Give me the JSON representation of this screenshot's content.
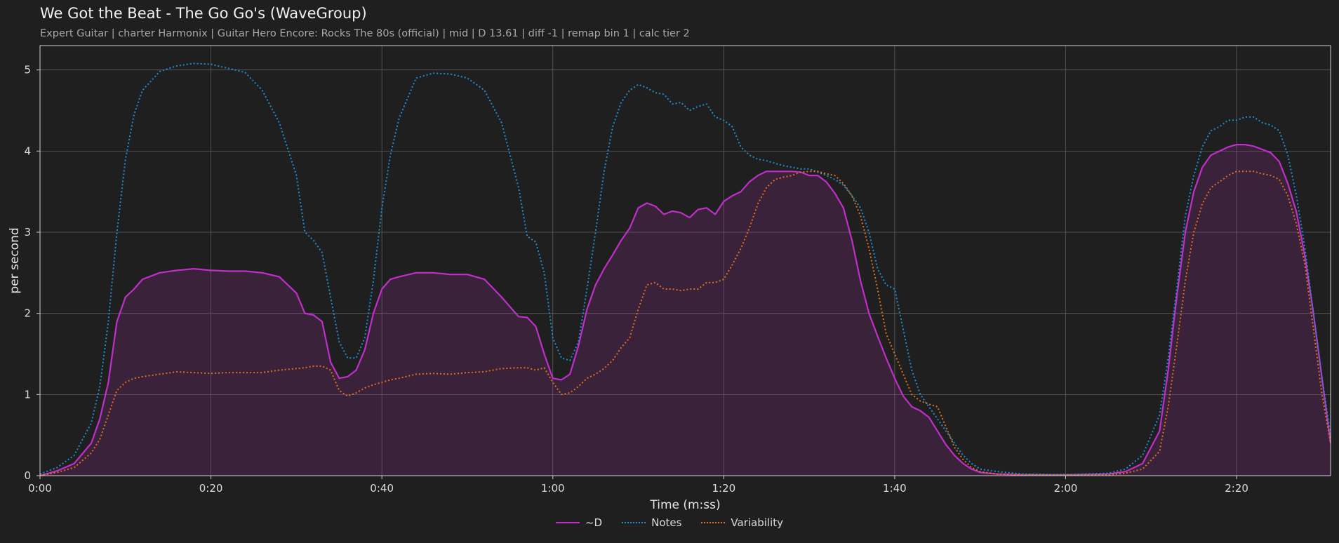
{
  "title": "We Got the Beat - The Go Go's (WaveGroup)",
  "subtitle": "Expert Guitar  |  charter Harmonix  |  Guitar Hero Encore: Rocks The 80s (official)  |  mid  |  D 13.61  |  diff -1  |  remap bin 1  |  calc tier 2",
  "chart_data": {
    "type": "line",
    "title": "We Got the Beat - The Go Go's (WaveGroup)",
    "xlabel": "Time (m:ss)",
    "ylabel": "per second",
    "xlim": [
      0,
      151
    ],
    "ylim": [
      0,
      5.3
    ],
    "grid": true,
    "legend_position": "bottom-center",
    "xticks": [
      0,
      20,
      40,
      60,
      80,
      100,
      120,
      140
    ],
    "xtick_labels": [
      "0:00",
      "0:20",
      "0:40",
      "1:00",
      "1:20",
      "1:40",
      "2:00",
      "2:20"
    ],
    "yticks": [
      0,
      1,
      2,
      3,
      4,
      5
    ],
    "ytick_labels": [
      "0",
      "1",
      "2",
      "3",
      "4",
      "5"
    ],
    "x": [
      0,
      2,
      4,
      6,
      7,
      8,
      9,
      10,
      11,
      12,
      14,
      16,
      18,
      20,
      22,
      24,
      26,
      28,
      30,
      31,
      32,
      33,
      34,
      35,
      36,
      37,
      38,
      39,
      40,
      41,
      42,
      44,
      46,
      48,
      50,
      52,
      54,
      56,
      57,
      58,
      59,
      60,
      61,
      62,
      63,
      64,
      65,
      66,
      67,
      68,
      69,
      70,
      71,
      72,
      73,
      74,
      75,
      76,
      77,
      78,
      79,
      80,
      81,
      82,
      83,
      84,
      85,
      86,
      87,
      88,
      89,
      90,
      91,
      92,
      93,
      94,
      95,
      96,
      97,
      98,
      99,
      100,
      101,
      102,
      103,
      104,
      105,
      106,
      107,
      108,
      109,
      110,
      112,
      115,
      120,
      125,
      127,
      129,
      131,
      132,
      133,
      134,
      135,
      136,
      137,
      138,
      139,
      140,
      141,
      142,
      143,
      144,
      145,
      146,
      147,
      148,
      149,
      150,
      151
    ],
    "series": [
      {
        "name": "~D",
        "color": "#c02fc9",
        "style": "solid",
        "fill": true,
        "values": [
          0.0,
          0.06,
          0.15,
          0.4,
          0.7,
          1.15,
          1.9,
          2.2,
          2.3,
          2.42,
          2.5,
          2.53,
          2.55,
          2.53,
          2.52,
          2.52,
          2.5,
          2.45,
          2.25,
          2.0,
          1.98,
          1.9,
          1.4,
          1.2,
          1.22,
          1.3,
          1.55,
          2.0,
          2.3,
          2.42,
          2.45,
          2.5,
          2.5,
          2.48,
          2.48,
          2.42,
          2.2,
          1.96,
          1.95,
          1.84,
          1.5,
          1.2,
          1.18,
          1.25,
          1.6,
          2.05,
          2.35,
          2.55,
          2.72,
          2.9,
          3.05,
          3.3,
          3.36,
          3.32,
          3.22,
          3.26,
          3.24,
          3.18,
          3.28,
          3.3,
          3.22,
          3.38,
          3.45,
          3.5,
          3.62,
          3.7,
          3.75,
          3.75,
          3.75,
          3.75,
          3.74,
          3.7,
          3.7,
          3.62,
          3.48,
          3.3,
          2.9,
          2.4,
          2.0,
          1.72,
          1.45,
          1.2,
          0.98,
          0.85,
          0.8,
          0.72,
          0.55,
          0.38,
          0.25,
          0.15,
          0.08,
          0.04,
          0.02,
          0.01,
          0.01,
          0.02,
          0.05,
          0.15,
          0.55,
          1.3,
          2.2,
          3.0,
          3.5,
          3.8,
          3.95,
          4.0,
          4.05,
          4.08,
          4.08,
          4.06,
          4.02,
          3.98,
          3.87,
          3.6,
          3.25,
          2.7,
          2.0,
          1.2,
          0.4
        ]
      },
      {
        "name": "Notes",
        "color": "#1f8fd0",
        "style": "dotted",
        "fill": false,
        "values": [
          0.02,
          0.1,
          0.25,
          0.65,
          1.1,
          1.9,
          3.0,
          3.9,
          4.45,
          4.75,
          4.98,
          5.05,
          5.08,
          5.07,
          5.02,
          4.97,
          4.75,
          4.35,
          3.7,
          3.0,
          2.9,
          2.75,
          2.2,
          1.65,
          1.45,
          1.45,
          1.7,
          2.4,
          3.3,
          3.95,
          4.4,
          4.9,
          4.96,
          4.95,
          4.9,
          4.75,
          4.35,
          3.55,
          2.95,
          2.88,
          2.5,
          1.7,
          1.45,
          1.42,
          1.65,
          2.3,
          3.0,
          3.75,
          4.3,
          4.6,
          4.75,
          4.82,
          4.78,
          4.72,
          4.7,
          4.58,
          4.6,
          4.5,
          4.55,
          4.58,
          4.42,
          4.38,
          4.3,
          4.05,
          3.95,
          3.9,
          3.88,
          3.85,
          3.82,
          3.8,
          3.78,
          3.78,
          3.74,
          3.7,
          3.65,
          3.58,
          3.45,
          3.3,
          3.0,
          2.55,
          2.35,
          2.3,
          1.8,
          1.3,
          1.0,
          0.85,
          0.7,
          0.55,
          0.4,
          0.25,
          0.15,
          0.08,
          0.05,
          0.02,
          0.01,
          0.03,
          0.08,
          0.25,
          0.75,
          1.45,
          2.3,
          3.2,
          3.7,
          4.05,
          4.25,
          4.3,
          4.38,
          4.38,
          4.42,
          4.42,
          4.35,
          4.32,
          4.25,
          3.95,
          3.45,
          2.8,
          2.0,
          1.2,
          0.5
        ]
      },
      {
        "name": "Variability",
        "color": "#e0701e",
        "style": "dotted",
        "fill": false,
        "values": [
          0.0,
          0.04,
          0.1,
          0.28,
          0.45,
          0.75,
          1.05,
          1.15,
          1.2,
          1.22,
          1.25,
          1.28,
          1.27,
          1.26,
          1.27,
          1.27,
          1.27,
          1.3,
          1.32,
          1.33,
          1.35,
          1.35,
          1.3,
          1.05,
          0.98,
          1.02,
          1.08,
          1.12,
          1.15,
          1.18,
          1.2,
          1.25,
          1.26,
          1.25,
          1.27,
          1.28,
          1.32,
          1.33,
          1.33,
          1.3,
          1.33,
          1.15,
          1.0,
          1.02,
          1.1,
          1.2,
          1.25,
          1.32,
          1.42,
          1.58,
          1.7,
          2.05,
          2.35,
          2.38,
          2.3,
          2.3,
          2.28,
          2.3,
          2.3,
          2.38,
          2.38,
          2.42,
          2.6,
          2.8,
          3.05,
          3.35,
          3.55,
          3.65,
          3.68,
          3.7,
          3.74,
          3.75,
          3.75,
          3.72,
          3.7,
          3.6,
          3.45,
          3.2,
          2.8,
          2.3,
          1.75,
          1.5,
          1.25,
          1.0,
          0.92,
          0.88,
          0.85,
          0.6,
          0.35,
          0.2,
          0.1,
          0.05,
          0.02,
          0.01,
          0.01,
          0.01,
          0.03,
          0.08,
          0.3,
          0.85,
          1.6,
          2.4,
          3.0,
          3.35,
          3.55,
          3.62,
          3.7,
          3.75,
          3.75,
          3.75,
          3.72,
          3.7,
          3.65,
          3.45,
          3.1,
          2.6,
          1.8,
          1.0,
          0.4
        ]
      }
    ]
  }
}
